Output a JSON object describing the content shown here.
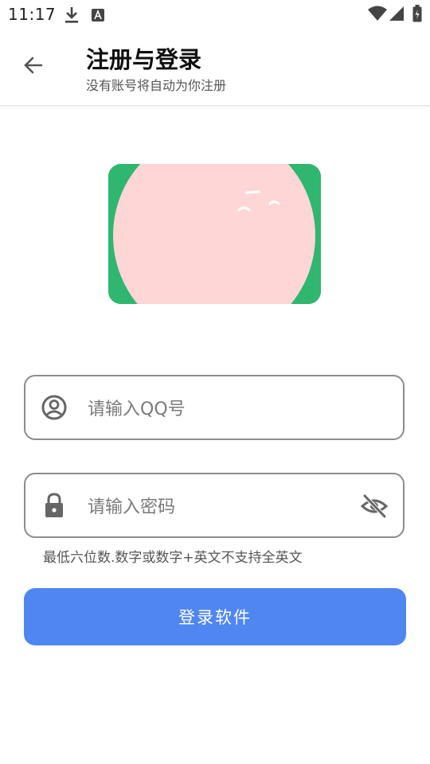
{
  "status_bar": {
    "time": "11:17",
    "icons": [
      "download-icon",
      "a-notification-icon",
      "wifi-icon",
      "signal-icon",
      "battery-icon"
    ]
  },
  "app_bar": {
    "title": "注册与登录",
    "subtitle": "没有账号将自动为你注册",
    "back_icon": "arrow-left-icon"
  },
  "form": {
    "qq_input": {
      "placeholder": "请输入QQ号",
      "value": "",
      "icon": "account-circle-icon"
    },
    "password_input": {
      "placeholder": "请输入密码",
      "value": "",
      "icon": "lock-icon",
      "toggle_icon": "eye-off-icon"
    },
    "hint": "最低六位数.数字或数字+英文不支持全英文",
    "login_button": "登录软件"
  },
  "colors": {
    "primary_button": "#4f86f1",
    "illustration_bg": "#2fb66f",
    "illustration_circle": "#ffd6d6",
    "field_border": "#8c8c8c"
  }
}
